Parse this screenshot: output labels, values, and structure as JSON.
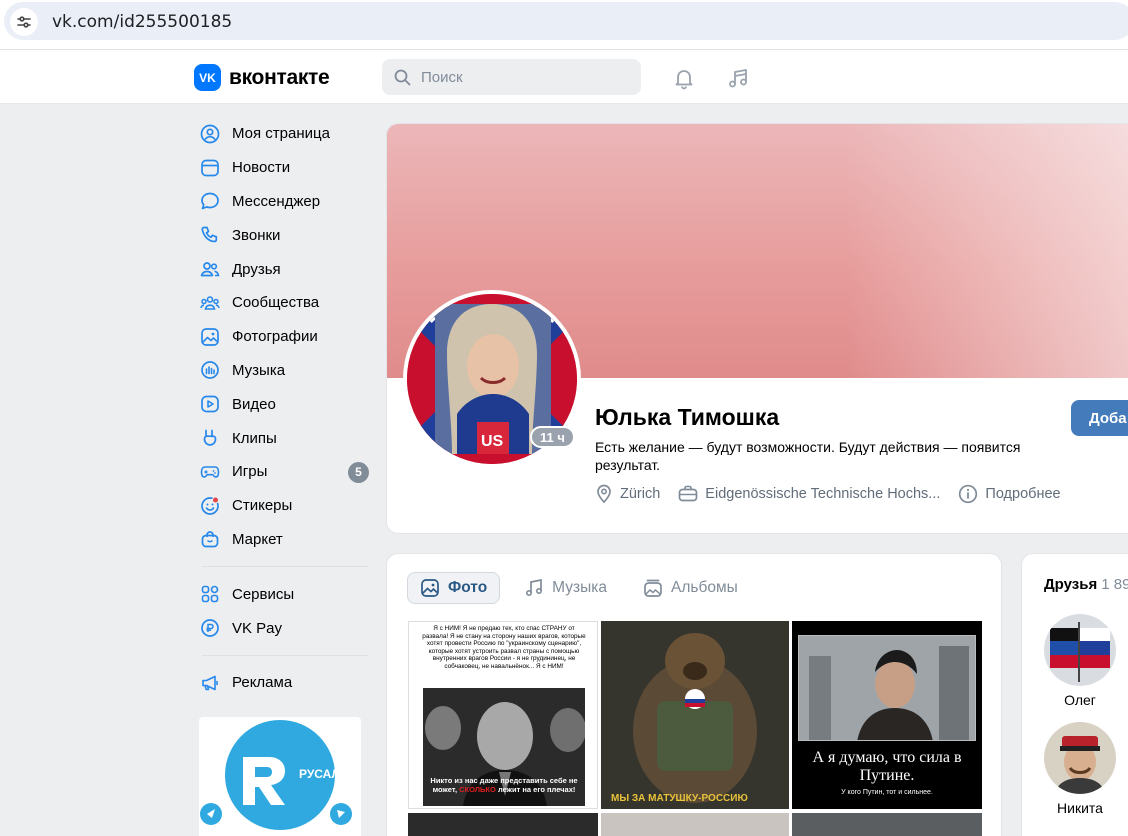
{
  "browser": {
    "url": "vk.com/id255500185"
  },
  "header": {
    "logo_badge": "VK",
    "logo_text": "вконтакте",
    "search_placeholder": "Поиск"
  },
  "menu": {
    "items": [
      {
        "label": "Моя страница",
        "icon": "user-circle-icon"
      },
      {
        "label": "Новости",
        "icon": "news-icon"
      },
      {
        "label": "Мессенджер",
        "icon": "message-bubble-icon"
      },
      {
        "label": "Звонки",
        "icon": "phone-icon"
      },
      {
        "label": "Друзья",
        "icon": "friends-icon"
      },
      {
        "label": "Сообщества",
        "icon": "communities-icon"
      },
      {
        "label": "Фотографии",
        "icon": "photo-icon"
      },
      {
        "label": "Музыка",
        "icon": "music-bars-icon"
      },
      {
        "label": "Видео",
        "icon": "video-icon"
      },
      {
        "label": "Клипы",
        "icon": "clips-icon"
      },
      {
        "label": "Игры",
        "icon": "gamepad-icon",
        "badge": "5"
      },
      {
        "label": "Стикеры",
        "icon": "sticker-icon"
      },
      {
        "label": "Маркет",
        "icon": "bag-icon"
      }
    ],
    "extra": [
      {
        "label": "Сервисы",
        "icon": "grid-icon"
      },
      {
        "label": "VK Pay",
        "icon": "ruble-coin-icon"
      }
    ],
    "ads": {
      "label": "Реклама",
      "icon": "megaphone-icon"
    },
    "ad_banner_text": "РУСАЛ"
  },
  "profile": {
    "name": "Юлька Тимошка",
    "status": "Есть желание — будут возможности. Будут действия — появится результат.",
    "online": "11 ч",
    "city": "Zürich",
    "education": "Eidgenössische Technische Hochs...",
    "more": "Подробнее",
    "add_button": "Доба"
  },
  "media": {
    "tabs": [
      {
        "label": "Фото",
        "icon": "photo-icon",
        "active": true
      },
      {
        "label": "Музыка",
        "icon": "music-note-icon",
        "active": false
      },
      {
        "label": "Альбомы",
        "icon": "albums-icon",
        "active": false
      }
    ],
    "photo1": {
      "text_top": "Я с НИМ! Я не предаю тех, кто спас СТРАНУ от развала! Я не стану на сторону наших врагов, которые хотят провести Россию по \"украинскому сценарию\", которые хотят устроить развал страны с помощью внутренних врагов России - я не грудининец, не собчаковец, не навальнёнок... Я с НИМ!",
      "text_bottom_1": "Никто из нас даже представить себе не может,",
      "text_bottom_red": "сколько",
      "text_bottom_2": "лежит на его плечах!"
    },
    "photo2": {
      "caption": "МЫ ЗА МАТУШКУ-РОССИЮ"
    },
    "photo3": {
      "title": "А я думаю, что сила в Путине.",
      "subtitle": "У кого Путин, тот и сильнее."
    }
  },
  "friends": {
    "title": "Друзья",
    "count": "1 89",
    "items": [
      {
        "name": "Олег"
      },
      {
        "name": "Никита"
      }
    ]
  },
  "colors": {
    "vk_blue": "#0077ff",
    "button_blue": "#447bba",
    "link_blue": "#2a5885",
    "cover_pink": "#e79d9c"
  }
}
